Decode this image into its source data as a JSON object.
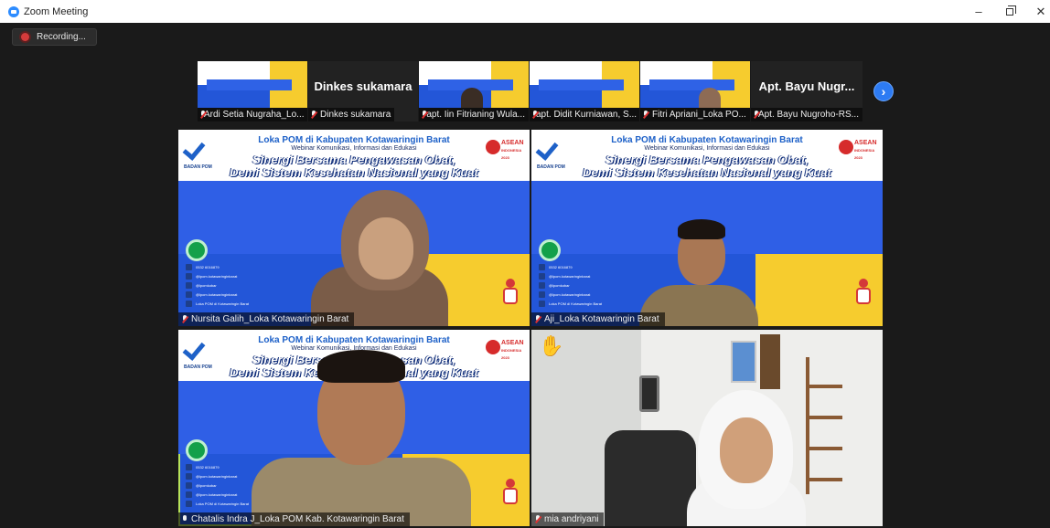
{
  "window": {
    "title": "Zoom Meeting",
    "controls": {
      "minimize": "–",
      "restore": "",
      "close": "✕"
    }
  },
  "recording": {
    "label": "Recording..."
  },
  "thumbnails": [
    {
      "name": "Ardi Setia Nugraha_Lo...",
      "muted": true,
      "video": "banner"
    },
    {
      "name": "Dinkes sukamara",
      "muted": true,
      "video": "name",
      "display_name": "Dinkes sukamara"
    },
    {
      "name": "apt. Iin Fitrianing Wula...",
      "muted": true,
      "video": "banner-person"
    },
    {
      "name": "apt. Didit Kurniawan, S...",
      "muted": true,
      "video": "banner"
    },
    {
      "name": "Fitri Apriani_Loka PO...",
      "muted": true,
      "video": "banner-person"
    },
    {
      "name": "Apt. Bayu Nugroho-RS...",
      "muted": true,
      "video": "name",
      "display_name": "Apt. Bayu Nugr..."
    }
  ],
  "next_page_icon": "chevron-right-icon",
  "banner": {
    "heading": "Loka POM di Kabupaten Kotawaringin Barat",
    "subheading": "Webinar Komunikasi, Informasi dan Edukasi",
    "title_line1": "Sinergi Bersama Pengawasan Obat,",
    "title_line2": "Demi Sistem Kesehatan Nasional yang Kuat",
    "logo_text": "BADAN POM",
    "asean_text": "ASEAN",
    "asean_sub": "INDONESIA 2023",
    "contact": [
      "0532 6016879",
      "@lpom.kotawaringinbarat",
      "@lpomkobar",
      "@lpom.kotawaringinbarat",
      "Loka POM di Kotawaringin Barat"
    ]
  },
  "gallery": [
    {
      "name": "Nursita Galih_Loka Kotawaringin Barat",
      "muted": true
    },
    {
      "name": "Aji_Loka Kotawaringin Barat",
      "muted": true
    },
    {
      "name": "Chatalis Indra J_Loka POM Kab. Kotawaringin Barat",
      "muted": false
    },
    {
      "name": "mia andriyani",
      "muted": true,
      "raised_hand": "✋"
    }
  ],
  "colors": {
    "active_speaker_border": "#b7e25a",
    "accent": "#2d8cff",
    "recording_dot": "#d43b3b"
  }
}
